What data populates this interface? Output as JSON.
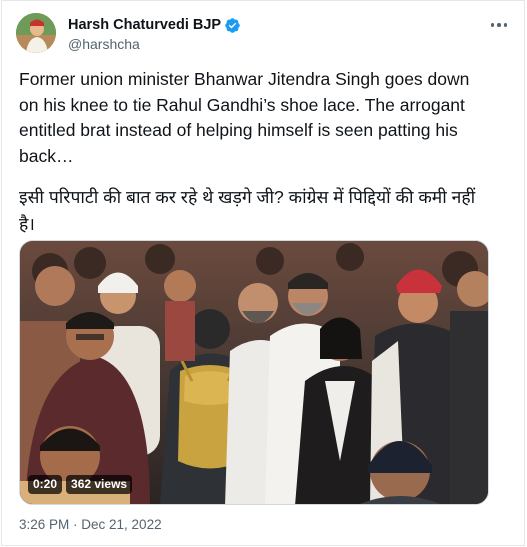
{
  "author": {
    "display_name": "Harsh Chaturvedi BJP",
    "handle": "@harshcha",
    "verified": true,
    "verified_color": "#1d9bf0"
  },
  "tweet": {
    "text_en": "Former union minister Bhanwar Jitendra Singh goes down on his knee to tie Rahul Gandhi’s shoe lace. The arrogant entitled brat instead of helping himself is seen patting his back…",
    "text_hi": "इसी परिपाटी की बात कर रहे थे खड़गे जी? कांग्रेस में पिद्दियों की कमी नहीं है।"
  },
  "video": {
    "duration": "0:20",
    "views": "362 views"
  },
  "meta": {
    "timestamp": "3:26 PM · Dec 21, 2022"
  },
  "icons": {
    "avatar": "profile-photo",
    "verified": "verified-badge-icon",
    "more": "more-options-icon"
  }
}
